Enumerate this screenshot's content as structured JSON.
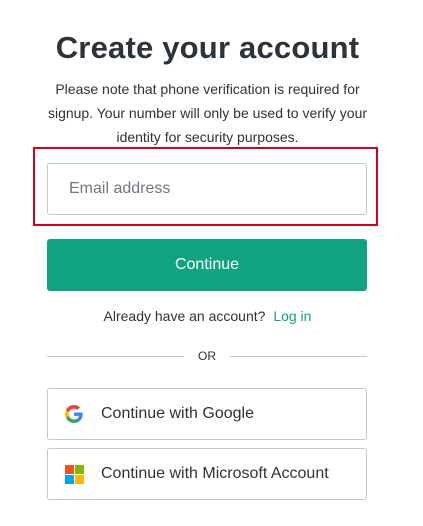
{
  "page": {
    "title": "Create your account",
    "subtitle": "Please note that phone verification is required for signup. Your number will only be used to verify your identity for security purposes."
  },
  "form": {
    "email_placeholder": "Email address",
    "email_value": "",
    "continue_label": "Continue"
  },
  "signin": {
    "prompt": "Already have an account?",
    "link_label": "Log in"
  },
  "divider": {
    "label": "OR"
  },
  "social": {
    "google_label": "Continue with Google",
    "microsoft_label": "Continue with Microsoft Account"
  },
  "colors": {
    "accent": "#10a37f",
    "highlight": "#d0021b",
    "text": "#2d333a",
    "border": "#c2c8d0"
  },
  "icons": {
    "google": "google-icon",
    "microsoft": "microsoft-icon"
  }
}
